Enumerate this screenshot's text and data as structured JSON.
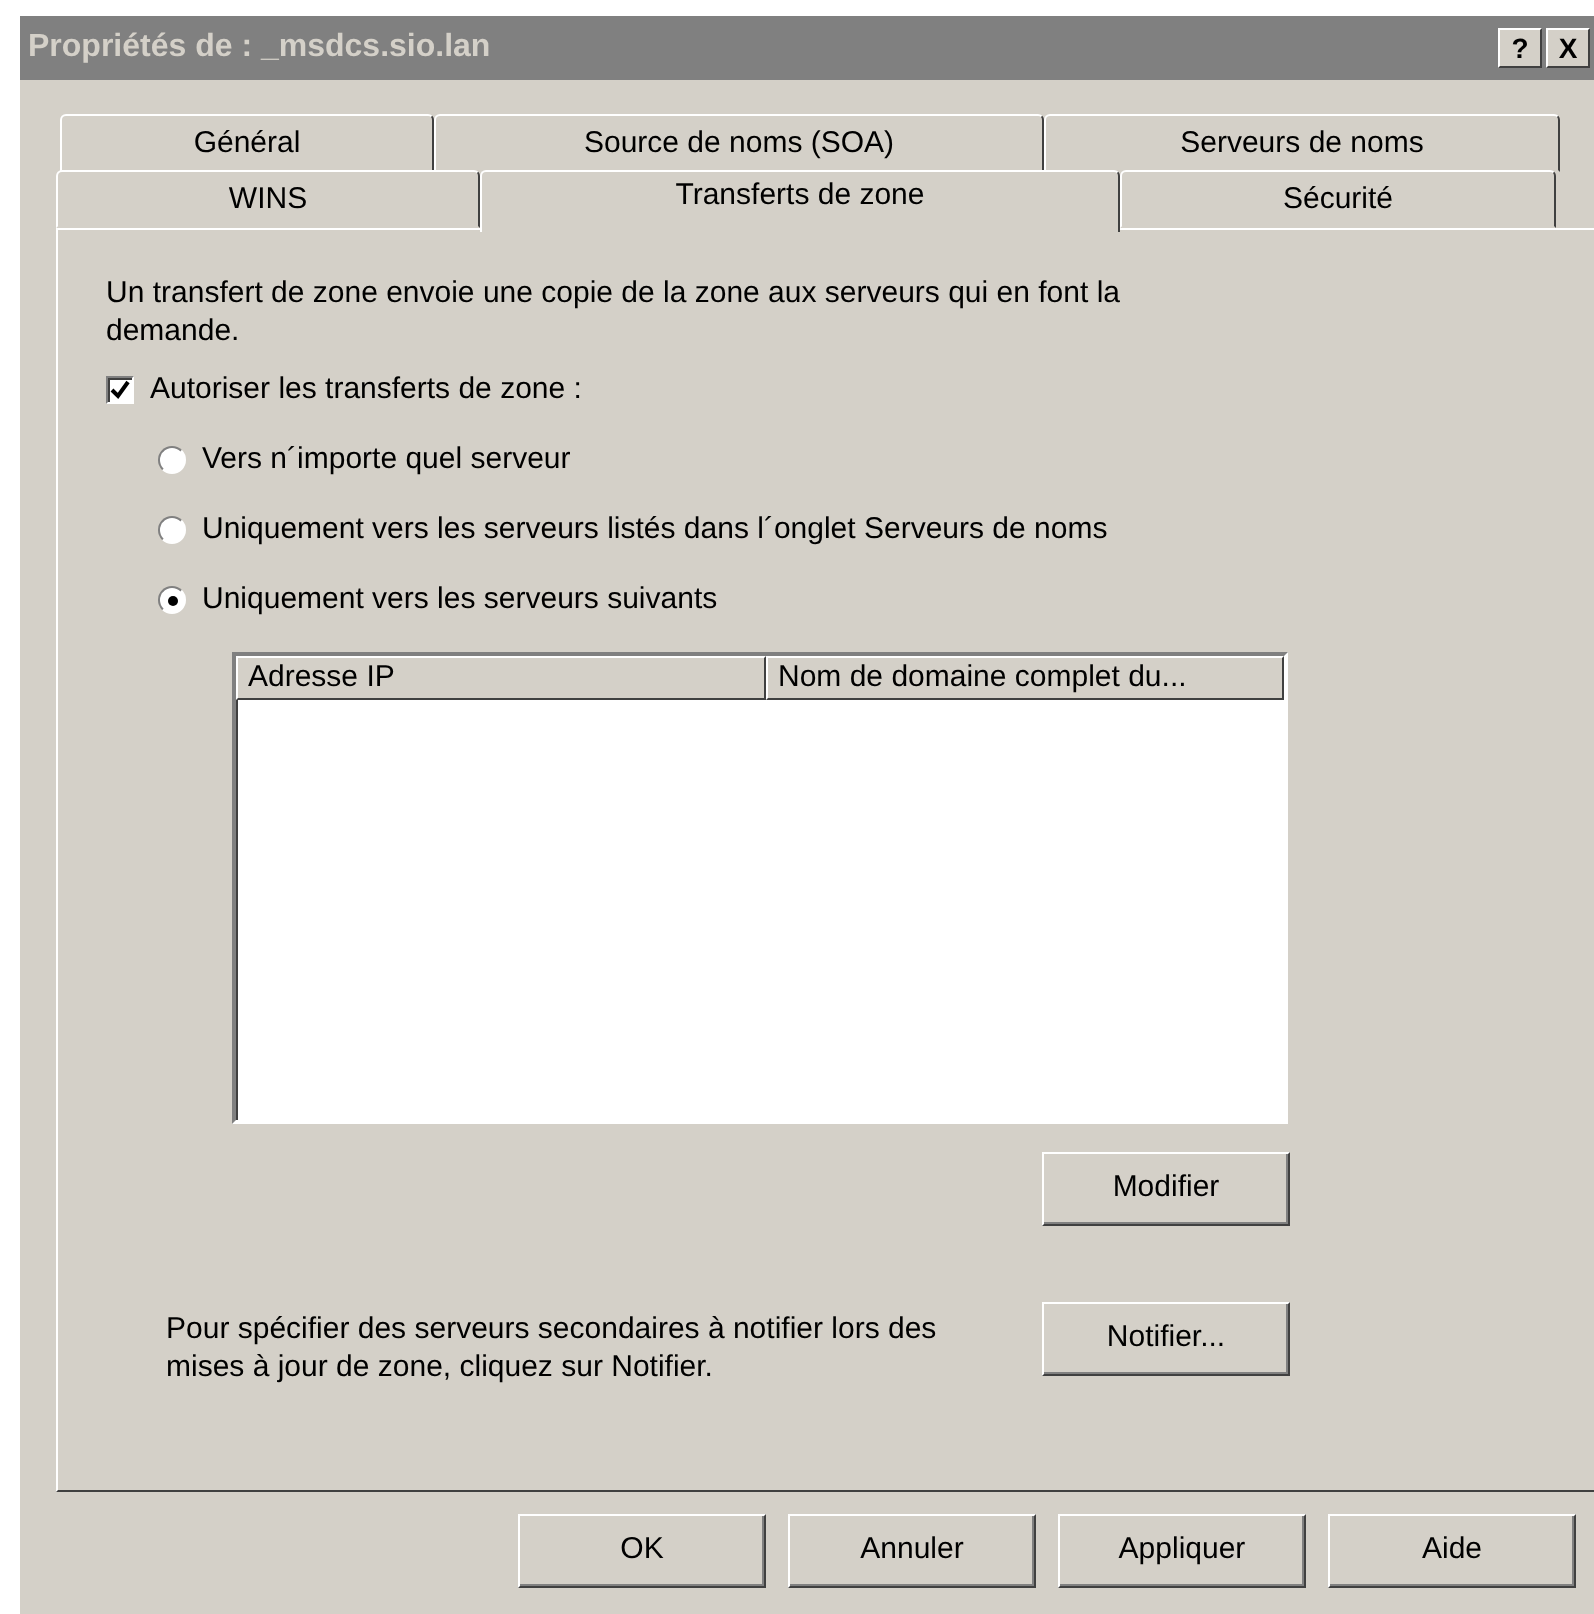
{
  "window": {
    "title": "Propriétés de : _msdcs.sio.lan",
    "title_buttons": [
      "?",
      "X"
    ]
  },
  "tab_rows": [
    [
      {
        "label": "Général",
        "selected": false
      },
      {
        "label": "Source de noms (SOA)",
        "selected": false
      },
      {
        "label": "Serveurs de noms",
        "selected": false
      }
    ],
    [
      {
        "label": "WINS",
        "selected": false
      },
      {
        "label": "Transferts de zone",
        "selected": true
      },
      {
        "label": "Sécurité",
        "selected": false
      }
    ]
  ],
  "description": "Un transfert de zone envoie une copie de la zone aux serveurs qui en font la demande.",
  "allow_transfers": {
    "label": "Autoriser les transferts de zone :",
    "checked": true
  },
  "options": [
    {
      "label": "Vers n´importe quel serveur",
      "selected": false
    },
    {
      "label": "Uniquement vers les serveurs listés dans l´onglet Serveurs de noms",
      "selected": false
    },
    {
      "label": "Uniquement vers les serveurs suivants",
      "selected": true
    }
  ],
  "servers_table": {
    "columns": [
      "Adresse IP",
      "Nom de domaine complet du..."
    ]
  },
  "modify_button": "Modifier",
  "notify": {
    "text": "Pour spécifier des serveurs secondaires à notifier lors des mises à jour de zone, cliquez sur Notifier.",
    "button": "Notifier..."
  },
  "buttons": [
    "OK",
    "Annuler",
    "Appliquer",
    "Aide"
  ]
}
